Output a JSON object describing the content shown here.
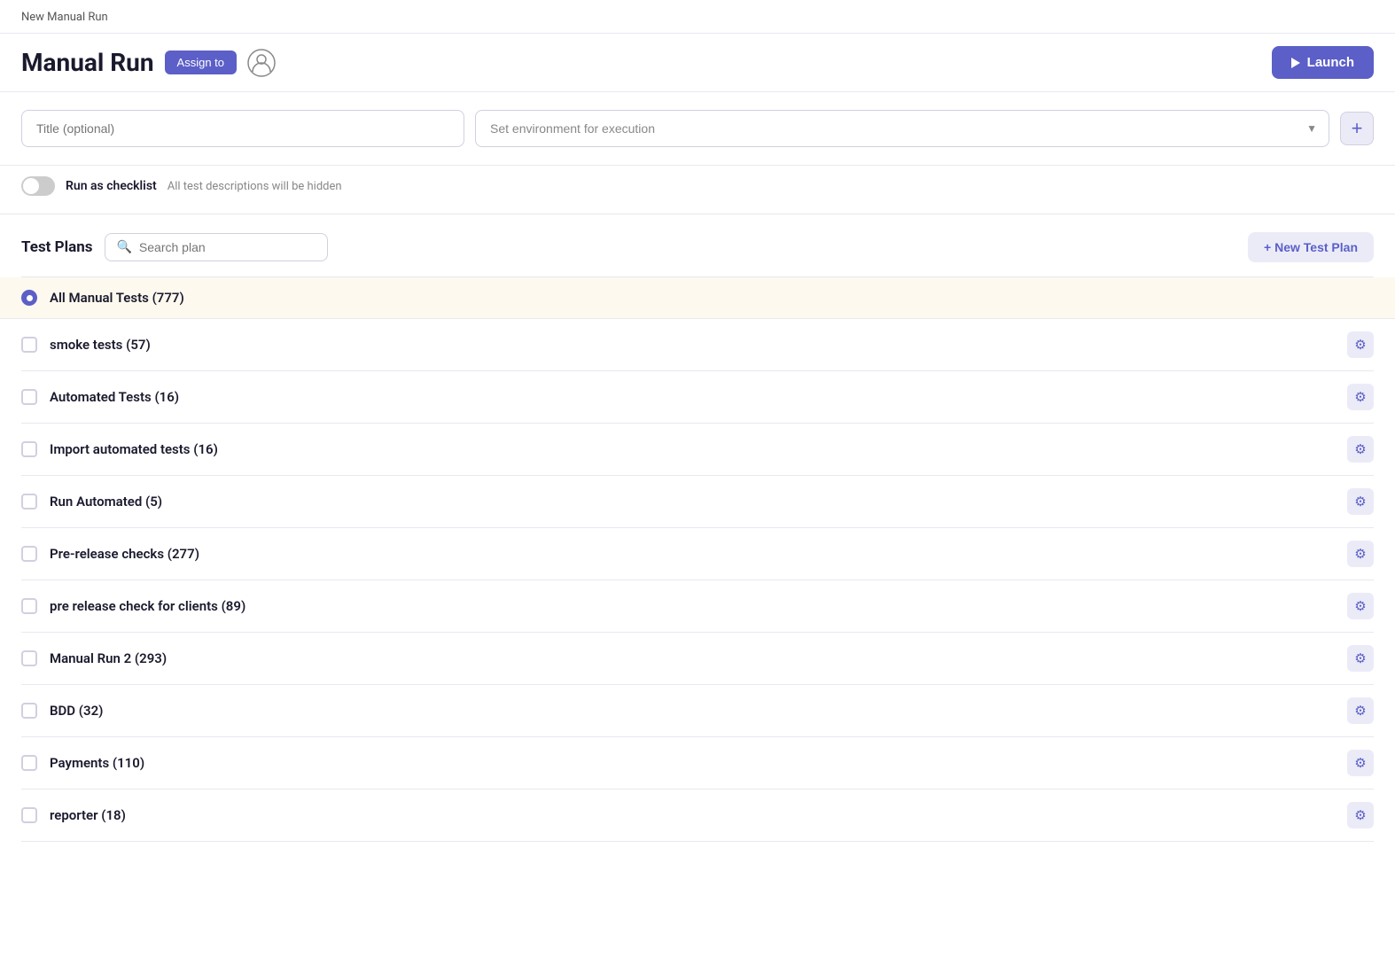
{
  "breadcrumb": "New Manual Run",
  "header": {
    "title": "Manual Run",
    "assign_label": "Assign to",
    "launch_label": "Launch"
  },
  "form": {
    "title_placeholder": "Title (optional)",
    "env_placeholder": "Set environment for execution",
    "add_env_label": "+"
  },
  "checklist": {
    "label": "Run as checklist",
    "description": "All test descriptions will be hidden"
  },
  "plans": {
    "title": "Test Plans",
    "search_placeholder": "Search plan",
    "new_plan_label": "+ New Test Plan",
    "items": [
      {
        "name": "All Manual Tests (777)",
        "selected": true,
        "type": "radio"
      },
      {
        "name": "smoke tests (57)",
        "selected": false,
        "type": "checkbox"
      },
      {
        "name": "Automated Tests (16)",
        "selected": false,
        "type": "checkbox"
      },
      {
        "name": "Import automated tests (16)",
        "selected": false,
        "type": "checkbox"
      },
      {
        "name": "Run Automated (5)",
        "selected": false,
        "type": "checkbox"
      },
      {
        "name": "Pre-release checks (277)",
        "selected": false,
        "type": "checkbox"
      },
      {
        "name": "pre release check for clients (89)",
        "selected": false,
        "type": "checkbox"
      },
      {
        "name": "Manual Run 2 (293)",
        "selected": false,
        "type": "checkbox"
      },
      {
        "name": "BDD (32)",
        "selected": false,
        "type": "checkbox"
      },
      {
        "name": "Payments (110)",
        "selected": false,
        "type": "checkbox"
      },
      {
        "name": "reporter (18)",
        "selected": false,
        "type": "checkbox"
      }
    ]
  }
}
